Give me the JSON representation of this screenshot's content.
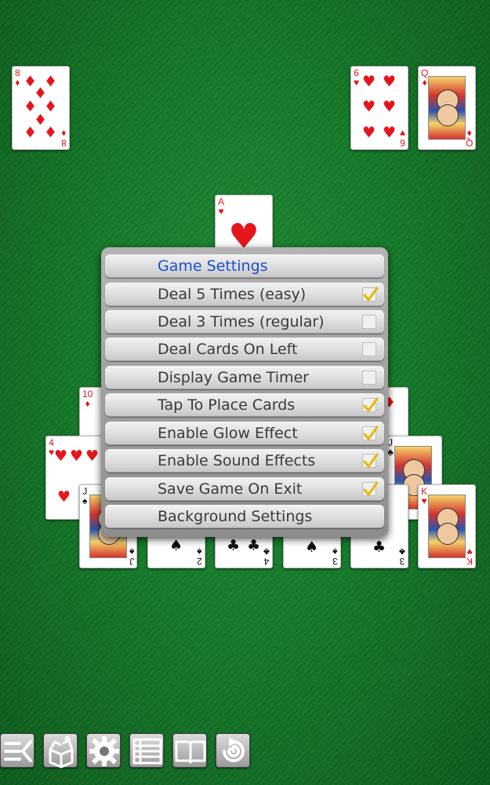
{
  "cards": {
    "top_left_8d": {
      "rank": "8",
      "suit": "♦"
    },
    "top_right_6h": {
      "rank": "6",
      "suit": "♥"
    },
    "top_right_qd": {
      "rank": "Q",
      "suit": "♦"
    },
    "foundation_ah": {
      "rank": "A",
      "suit": "♥"
    },
    "row2_10d": {
      "rank": "10",
      "suit": "♦"
    },
    "row3_4h": {
      "rank": "4",
      "suit": "♥"
    },
    "row3_jc": {
      "rank": "J",
      "suit": "♣"
    },
    "row4_js": {
      "rank": "J",
      "suit": "♠"
    },
    "row4_2s": {
      "rank": "2",
      "suit": "♠"
    },
    "row4_4c": {
      "rank": "4",
      "suit": "♣"
    },
    "row4_3s": {
      "rank": "3",
      "suit": "♠"
    },
    "row4_3c": {
      "rank": "3",
      "suit": "♣"
    },
    "row4_kh": {
      "rank": "K",
      "suit": "♥"
    }
  },
  "settings_menu": {
    "title": "Game Settings",
    "items": [
      {
        "label": "Deal 5 Times (easy)",
        "checked": true
      },
      {
        "label": "Deal 3 Times (regular)",
        "checked": false
      },
      {
        "label": "Deal Cards On Left",
        "checked": false
      },
      {
        "label": "Display Game Timer",
        "checked": false
      },
      {
        "label": "Tap To Place Cards",
        "checked": true
      },
      {
        "label": "Enable Glow Effect",
        "checked": true
      },
      {
        "label": "Enable Sound Effects",
        "checked": true
      },
      {
        "label": "Save Game On Exit",
        "checked": true
      }
    ],
    "background_label": "Background Settings"
  },
  "toolbar": {
    "icons": [
      "menu-icon",
      "new-game-box-icon",
      "gear-icon",
      "list-icon",
      "book-icon",
      "undo-spiral-icon"
    ]
  },
  "colors": {
    "felt": "#137a28",
    "red_suit": "#e4161c",
    "title_blue": "#1a4fd0",
    "check_gold": "#e6b800"
  }
}
